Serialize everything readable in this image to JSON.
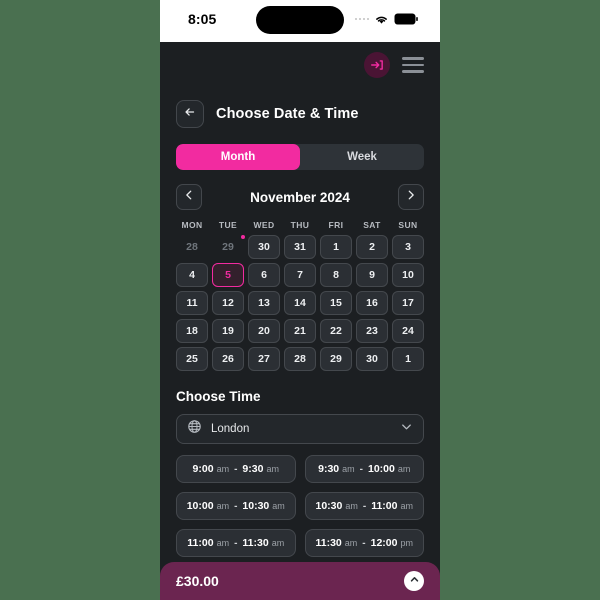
{
  "status_bar": {
    "time": "8:05",
    "signal_icon": "signal-dots-icon",
    "wifi_icon": "wifi-icon",
    "battery_icon": "battery-icon"
  },
  "header": {
    "login_icon": "login-arrow-icon",
    "menu_icon": "hamburger-menu-icon",
    "back_icon": "arrow-left-icon",
    "title": "Choose Date & Time"
  },
  "view_toggle": {
    "options": [
      {
        "label": "Month",
        "active": true
      },
      {
        "label": "Week",
        "active": false
      }
    ]
  },
  "calendar": {
    "prev_icon": "chevron-left-icon",
    "next_icon": "chevron-right-icon",
    "month_label": "November 2024",
    "weekdays": [
      "MON",
      "TUE",
      "WED",
      "THU",
      "FRI",
      "SAT",
      "SUN"
    ],
    "days": [
      {
        "label": "28",
        "state": "muted"
      },
      {
        "label": "29",
        "state": "muted",
        "dot": true
      },
      {
        "label": "30",
        "state": "normal"
      },
      {
        "label": "31",
        "state": "normal"
      },
      {
        "label": "1",
        "state": "normal"
      },
      {
        "label": "2",
        "state": "normal"
      },
      {
        "label": "3",
        "state": "normal"
      },
      {
        "label": "4",
        "state": "normal"
      },
      {
        "label": "5",
        "state": "selected"
      },
      {
        "label": "6",
        "state": "normal"
      },
      {
        "label": "7",
        "state": "normal"
      },
      {
        "label": "8",
        "state": "normal"
      },
      {
        "label": "9",
        "state": "normal"
      },
      {
        "label": "10",
        "state": "normal"
      },
      {
        "label": "11",
        "state": "normal"
      },
      {
        "label": "12",
        "state": "normal"
      },
      {
        "label": "13",
        "state": "normal"
      },
      {
        "label": "14",
        "state": "normal"
      },
      {
        "label": "15",
        "state": "normal"
      },
      {
        "label": "16",
        "state": "normal"
      },
      {
        "label": "17",
        "state": "normal"
      },
      {
        "label": "18",
        "state": "normal"
      },
      {
        "label": "19",
        "state": "normal"
      },
      {
        "label": "20",
        "state": "normal"
      },
      {
        "label": "21",
        "state": "normal"
      },
      {
        "label": "22",
        "state": "normal"
      },
      {
        "label": "23",
        "state": "normal"
      },
      {
        "label": "24",
        "state": "normal"
      },
      {
        "label": "25",
        "state": "normal"
      },
      {
        "label": "26",
        "state": "normal"
      },
      {
        "label": "27",
        "state": "normal"
      },
      {
        "label": "28",
        "state": "normal"
      },
      {
        "label": "29",
        "state": "normal"
      },
      {
        "label": "30",
        "state": "normal"
      },
      {
        "label": "1",
        "state": "normal"
      }
    ]
  },
  "choose_time": {
    "title": "Choose Time",
    "timezone": {
      "globe_icon": "globe-icon",
      "value": "London",
      "chevron_icon": "chevron-down-icon"
    },
    "separator": "-",
    "slots": [
      {
        "start_time": "9:00",
        "start_meridiem": "am",
        "end_time": "9:30",
        "end_meridiem": "am"
      },
      {
        "start_time": "9:30",
        "start_meridiem": "am",
        "end_time": "10:00",
        "end_meridiem": "am"
      },
      {
        "start_time": "10:00",
        "start_meridiem": "am",
        "end_time": "10:30",
        "end_meridiem": "am"
      },
      {
        "start_time": "10:30",
        "start_meridiem": "am",
        "end_time": "11:00",
        "end_meridiem": "am"
      },
      {
        "start_time": "11:00",
        "start_meridiem": "am",
        "end_time": "11:30",
        "end_meridiem": "am"
      },
      {
        "start_time": "11:30",
        "start_meridiem": "am",
        "end_time": "12:00",
        "end_meridiem": "pm"
      },
      {
        "start_time": "",
        "start_meridiem": "",
        "end_time": "",
        "end_meridiem": ""
      },
      {
        "start_time": "",
        "start_meridiem": "",
        "end_time": "",
        "end_meridiem": ""
      }
    ]
  },
  "bottom_bar": {
    "price": "£30.00",
    "expand_icon": "chevron-up-icon"
  },
  "colors": {
    "page_background": "#4a7050",
    "app_background": "#1c1f22",
    "accent_pink": "#f22ba0",
    "bottom_bar": "#6b2550",
    "card": "#2b2f34",
    "border": "#44484d"
  }
}
